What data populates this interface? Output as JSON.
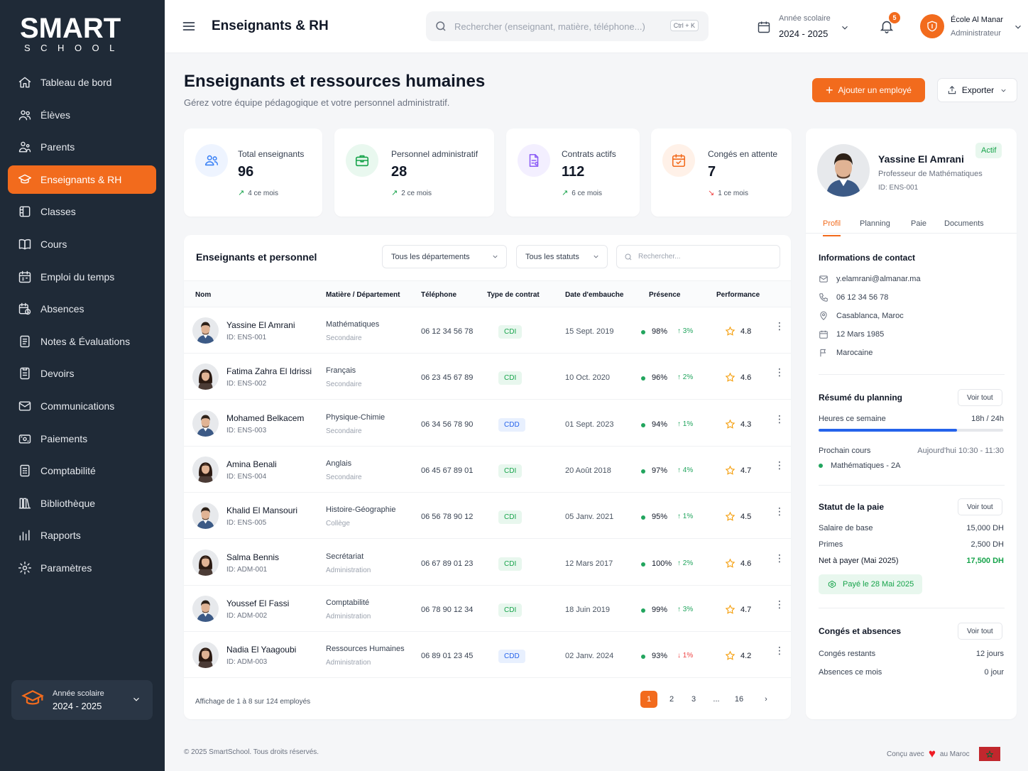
{
  "brand": {
    "logo_main": "SMART",
    "logo_sub": "SCHOOL"
  },
  "sidebar": {
    "items": [
      {
        "label": "Tableau de bord",
        "icon": "home-icon"
      },
      {
        "label": "Élèves",
        "icon": "students-icon"
      },
      {
        "label": "Parents",
        "icon": "parents-icon"
      },
      {
        "label": "Enseignants & RH",
        "icon": "teacher-icon",
        "active": true
      },
      {
        "label": "Classes",
        "icon": "classes-icon"
      },
      {
        "label": "Cours",
        "icon": "book-icon"
      },
      {
        "label": "Emploi du temps",
        "icon": "calendar-icon"
      },
      {
        "label": "Absences",
        "icon": "absences-icon"
      },
      {
        "label": "Notes & Évaluations",
        "icon": "notes-icon"
      },
      {
        "label": "Devoirs",
        "icon": "homework-icon"
      },
      {
        "label": "Communications",
        "icon": "mail-icon"
      },
      {
        "label": "Paiements",
        "icon": "payment-icon"
      },
      {
        "label": "Comptabilité",
        "icon": "accounting-icon"
      },
      {
        "label": "Bibliothèque",
        "icon": "library-icon"
      },
      {
        "label": "Rapports",
        "icon": "chart-icon"
      },
      {
        "label": "Paramètres",
        "icon": "gear-icon"
      }
    ],
    "year_label": "Année scolaire",
    "year_value": "2024 - 2025"
  },
  "topbar": {
    "title": "Enseignants & RH",
    "search_placeholder": "Rechercher (enseignant, matière, téléphone...)",
    "shortcut": "Ctrl + K",
    "year_label": "Année scolaire",
    "year_value": "2024 - 2025",
    "notifications": "5",
    "school_name": "École Al Manar",
    "school_role": "Administrateur"
  },
  "page": {
    "title": "Enseignants et ressources humaines",
    "subtitle": "Gérez votre équipe pédagogique et votre personnel administratif.",
    "add_button": "Ajouter un employé",
    "export_button": "Exporter"
  },
  "stats": [
    {
      "label": "Total enseignants",
      "value": "96",
      "trend": "4 ce mois",
      "dir": "up",
      "icon": "users-icon",
      "color": "#3b82f6",
      "bg": "#eef4ff"
    },
    {
      "label": "Personnel administratif",
      "value": "28",
      "trend": "2 ce mois",
      "dir": "up",
      "icon": "briefcase-icon",
      "color": "#16a34a",
      "bg": "#e9f8ef"
    },
    {
      "label": "Contrats actifs",
      "value": "112",
      "trend": "6 ce mois",
      "dir": "up",
      "icon": "contract-icon",
      "color": "#8b5cf6",
      "bg": "#f3efff"
    },
    {
      "label": "Congés en attente",
      "value": "7",
      "trend": "1 ce mois",
      "dir": "down",
      "icon": "leave-calendar-icon",
      "color": "#f26b1d",
      "bg": "#fff1e8"
    }
  ],
  "table": {
    "title": "Enseignants et personnel",
    "filter_dept": "Tous les départements",
    "filter_status": "Tous les statuts",
    "search_placeholder": "Rechercher...",
    "columns": [
      "Nom",
      "Matière / Département",
      "Téléphone",
      "Type de contrat",
      "Date d'embauche",
      "Présence",
      "Performance"
    ],
    "rows": [
      {
        "name": "Yassine El Amrani",
        "id": "ID: ENS-001",
        "subject": "Mathématiques",
        "dept": "Secondaire",
        "phone": "06 12 34 56 78",
        "contract": "CDI",
        "date": "15 Sept. 2019",
        "presence": "98%",
        "trend": "3%",
        "dir": "up",
        "perf": "4.8",
        "gender": "m"
      },
      {
        "name": "Fatima Zahra El Idrissi",
        "id": "ID: ENS-002",
        "subject": "Français",
        "dept": "Secondaire",
        "phone": "06 23 45 67 89",
        "contract": "CDI",
        "date": "10 Oct. 2020",
        "presence": "96%",
        "trend": "2%",
        "dir": "up",
        "perf": "4.6",
        "gender": "f"
      },
      {
        "name": "Mohamed Belkacem",
        "id": "ID: ENS-003",
        "subject": "Physique-Chimie",
        "dept": "Secondaire",
        "phone": "06 34 56 78 90",
        "contract": "CDD",
        "date": "01 Sept. 2023",
        "presence": "94%",
        "trend": "1%",
        "dir": "up",
        "perf": "4.3",
        "gender": "m"
      },
      {
        "name": "Amina Benali",
        "id": "ID: ENS-004",
        "subject": "Anglais",
        "dept": "Secondaire",
        "phone": "06 45 67 89 01",
        "contract": "CDI",
        "date": "20 Août 2018",
        "presence": "97%",
        "trend": "4%",
        "dir": "up",
        "perf": "4.7",
        "gender": "f"
      },
      {
        "name": "Khalid El Mansouri",
        "id": "ID: ENS-005",
        "subject": "Histoire-Géographie",
        "dept": "Collège",
        "phone": "06 56 78 90 12",
        "contract": "CDI",
        "date": "05 Janv. 2021",
        "presence": "95%",
        "trend": "1%",
        "dir": "up",
        "perf": "4.5",
        "gender": "m"
      },
      {
        "name": "Salma Bennis",
        "id": "ID: ADM-001",
        "subject": "Secrétariat",
        "dept": "Administration",
        "phone": "06 67 89 01 23",
        "contract": "CDI",
        "date": "12 Mars 2017",
        "presence": "100%",
        "trend": "2%",
        "dir": "up",
        "perf": "4.6",
        "gender": "f"
      },
      {
        "name": "Youssef El Fassi",
        "id": "ID: ADM-002",
        "subject": "Comptabilité",
        "dept": "Administration",
        "phone": "06 78 90 12 34",
        "contract": "CDI",
        "date": "18 Juin 2019",
        "presence": "99%",
        "trend": "3%",
        "dir": "up",
        "perf": "4.7",
        "gender": "m"
      },
      {
        "name": "Nadia El Yaagoubi",
        "id": "ID: ADM-003",
        "subject": "Ressources Humaines",
        "dept": "Administration",
        "phone": "06 89 01 23 45",
        "contract": "CDD",
        "date": "02 Janv. 2024",
        "presence": "93%",
        "trend": "1%",
        "dir": "down",
        "perf": "4.2",
        "gender": "f"
      }
    ],
    "footer_info": "Affichage de 1 à 8 sur 124 employés",
    "pages": [
      "1",
      "2",
      "3",
      "...",
      "16"
    ],
    "current_page": "1"
  },
  "profile": {
    "name": "Yassine El Amrani",
    "role": "Professeur de Mathématiques",
    "id": "ID: ENS-001",
    "status": "Actif",
    "tabs": [
      "Profil",
      "Planning",
      "Paie",
      "Documents"
    ],
    "contact_title": "Informations de contact",
    "email": "y.elamrani@almanar.ma",
    "phone": "06 12 34 56 78",
    "city": "Casablanca, Maroc",
    "birthdate": "12 Mars 1985",
    "nationality": "Marocaine",
    "planning_title": "Résumé du planning",
    "see_all": "Voir tout",
    "hours_label": "Heures ce semaine",
    "hours_value": "18h / 24h",
    "hours_fraction": 0.75,
    "next_label": "Prochain cours",
    "next_time": "Aujourd'hui 10:30 - 11:30",
    "next_course": "Mathématiques - 2A",
    "pay_title": "Statut de la paie",
    "base_label": "Salaire de base",
    "base_value": "15,000 DH",
    "bonus_label": "Primes",
    "bonus_value": "2,500 DH",
    "net_label": "Net à payer (Mai 2025)",
    "net_value": "17,500 DH",
    "paid_label": "Payé le 28 Mai 2025",
    "leave_title": "Congés et absences",
    "leave_label": "Congés restants",
    "leave_value": "12 jours",
    "abs_label": "Absences ce mois",
    "abs_value": "0 jour"
  },
  "footer": {
    "copyright": "© 2025 SmartSchool. Tous droits réservés.",
    "made_prefix": "Conçu avec",
    "made_suffix": "au Maroc"
  }
}
